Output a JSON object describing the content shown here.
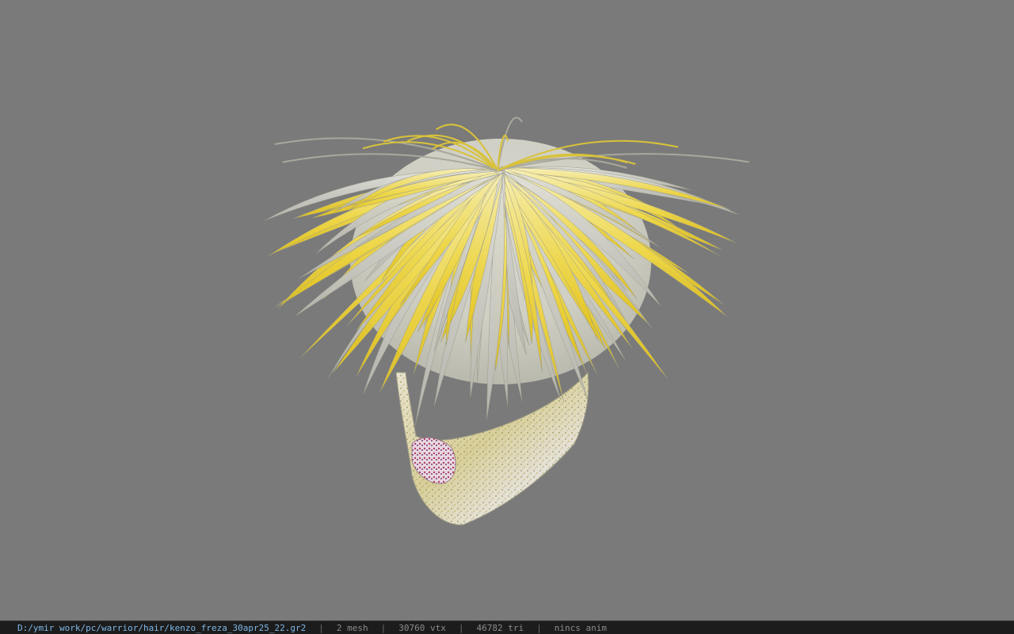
{
  "viewer": {
    "background_color": "#7a7a7a",
    "model_description_icon": "hair-mesh-model",
    "hair_colors": [
      "#f2dd3a",
      "#e8d560",
      "#c9c9c9",
      "#f7eeb0"
    ],
    "mask_colors": [
      "#e8e4d8",
      "#c8b84a",
      "#6a7a3a",
      "#b04a6a"
    ]
  },
  "status_bar": {
    "file_path": "D:/ymir work/pc/warrior/hair/kenzo_freza_30apr25_22.gr2",
    "separator": "|",
    "mesh_count": "2 mesh",
    "vertex_count": "30760 vtx",
    "triangle_count": "46782 tri",
    "anim_status": "nincs anim"
  }
}
